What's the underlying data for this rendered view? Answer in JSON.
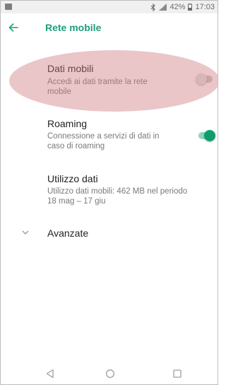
{
  "status_bar": {
    "battery": "42%",
    "time": "17:03",
    "icons": [
      "notification-icon",
      "bluetooth-icon",
      "signal-icon",
      "battery-icon"
    ]
  },
  "app_bar": {
    "title": "Rete mobile",
    "back_icon": "arrow-left-icon",
    "accent": "#1e9e7a"
  },
  "settings": {
    "dati_mobili": {
      "title": "Dati mobili",
      "subtitle_line1": "Accedi ai dati tramite la rete",
      "subtitle_line2": "mobile",
      "enabled": false
    },
    "roaming": {
      "title": "Roaming",
      "subtitle_line1": "Connessione a servizi di dati in",
      "subtitle_line2": "caso di roaming",
      "enabled": true
    },
    "utilizzo_dati": {
      "title": "Utilizzo dati",
      "subtitle_line1": "Utilizzo dati mobili: 462 MB nel periodo",
      "subtitle_line2": "18 mag – 17 giu"
    },
    "avanzate": {
      "title": "Avanzate"
    }
  },
  "nav_bar": {
    "icons": [
      "back-triangle-icon",
      "home-circle-icon",
      "recents-square-icon"
    ]
  }
}
